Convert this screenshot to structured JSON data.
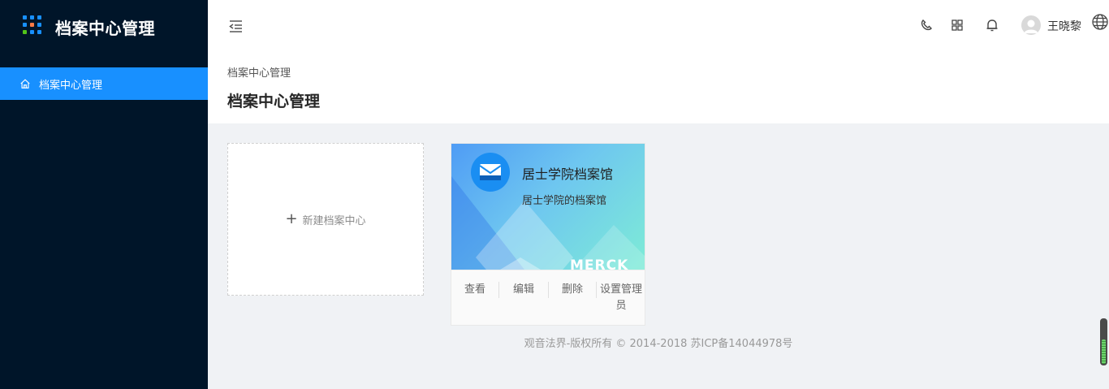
{
  "sidebar": {
    "brand_title": "档案中心管理",
    "menu": [
      {
        "label": "档案中心管理",
        "icon": "home-icon",
        "active": true
      }
    ],
    "accent": "#1890ff"
  },
  "header": {
    "icons": [
      "phone-icon",
      "apps-grid-icon",
      "bell-icon",
      "globe-icon"
    ],
    "user_name": "王晓黎"
  },
  "page": {
    "breadcrumb": "档案中心管理",
    "title": "档案中心管理"
  },
  "new_card": {
    "label": "新建档案中心"
  },
  "archives": [
    {
      "name": "居士学院档案馆",
      "description": "居士学院的档案馆",
      "watermark": "MERCK",
      "actions": [
        "查看",
        "编辑",
        "删除",
        "设置管理员"
      ]
    }
  ],
  "footer": {
    "text": "观音法界-版权所有 © 2014-2018 苏ICP备14044978号"
  }
}
